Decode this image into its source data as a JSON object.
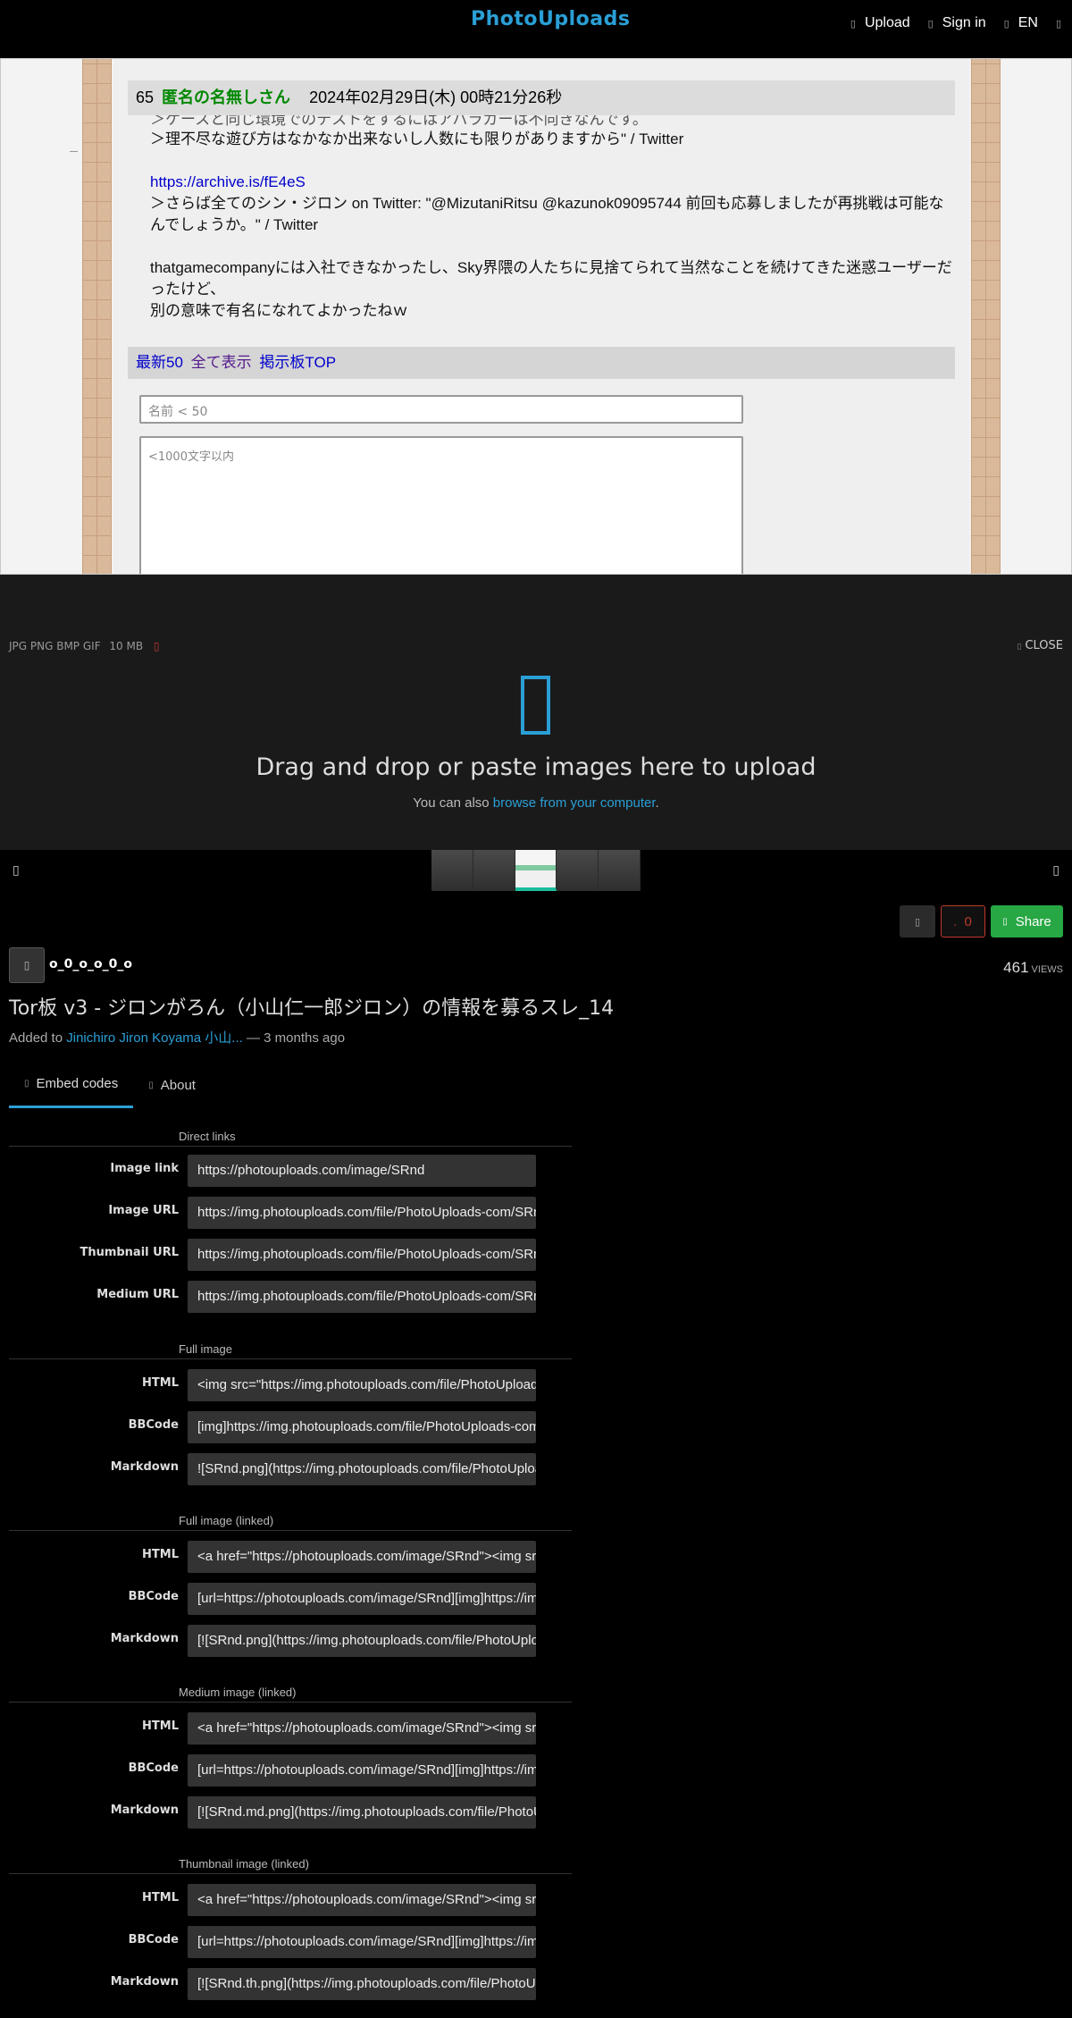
{
  "header": {
    "logo": "PhotoUploads",
    "nav": [
      {
        "icon": "upload-icon",
        "label": "Upload"
      },
      {
        "icon": "user-icon",
        "label": "Sign in"
      },
      {
        "icon": "globe-icon",
        "label": "EN"
      }
    ]
  },
  "preview": {
    "post_number": "65",
    "post_name": "匿名の名無しさん",
    "post_date": "2024年02月29日(木) 00時21分26秒",
    "line_partial": "＞ケースと同じ環境でのテストをするにはアバラガーは不向きなんです。",
    "line_1": "＞理不尽な遊び方はなかなか出来ないし人数にも限りがありますから\" / Twitter",
    "link": "https://archive.is/fE4eS",
    "line_2": "＞さらば全てのシン・ジロン on Twitter: \"@MizutaniRitsu @kazunok09095744 前回も応募しましたが再挑戦は可能なんでしょうか。\" / Twitter",
    "line_3": "thatgamecompanyには入社できなかったし、Sky界隈の人たちに見捨てられて当然なことを続けてきた迷惑ユーザーだったけど、",
    "line_4": "別の意味で有名になれてよかったねｗ",
    "nav_latest": "最新50",
    "nav_all": "全て表示",
    "nav_top": "掲示板TOP",
    "name_placeholder": "名前 < 50",
    "message_placeholder": "<1000文字以内"
  },
  "upload": {
    "formats": "JPG PNG BMP GIF",
    "max_size": "10 MB",
    "close": "CLOSE",
    "title": "Drag and drop or paste images here to upload",
    "sub_prefix": "You can also",
    "sub_link": "browse from your computer",
    "sub_suffix": "."
  },
  "image": {
    "likes": "0",
    "share": "Share",
    "username": "o_0_o_o_0_o",
    "views": "461",
    "views_label": "VIEWS",
    "title": "Tor板 v3 - ジロンがろん（小山仁一郎ジロン）の情報を募るスレ_14",
    "added_prefix": "Added to",
    "album": "Jinichiro Jiron Koyama 小山...",
    "added_suffix": "— 3 months ago"
  },
  "tabs": [
    {
      "icon": "code-icon",
      "label": "Embed codes"
    },
    {
      "icon": "info-icon",
      "label": "About"
    }
  ],
  "embed": {
    "direct": {
      "label": "Direct links",
      "rows": [
        {
          "label": "Image link",
          "value": "https://photouploads.com/image/SRnd"
        },
        {
          "label": "Image URL",
          "value": "https://img.photouploads.com/file/PhotoUploads-com/SRnd.png"
        },
        {
          "label": "Thumbnail URL",
          "value": "https://img.photouploads.com/file/PhotoUploads-com/SRnd.th.png"
        },
        {
          "label": "Medium URL",
          "value": "https://img.photouploads.com/file/PhotoUploads-com/SRnd.md.png"
        }
      ]
    },
    "full": {
      "label": "Full image",
      "rows": [
        {
          "label": "HTML",
          "value": "<img src=\"https://img.photouploads.com/file/PhotoUploads-com/SRnd.png\" alt=\"SRnd.png\" border=\"0\">"
        },
        {
          "label": "BBCode",
          "value": "[img]https://img.photouploads.com/file/PhotoUploads-com/SRnd.png[/img]"
        },
        {
          "label": "Markdown",
          "value": "![SRnd.png](https://img.photouploads.com/file/PhotoUploads-com/SRnd.png)"
        }
      ]
    },
    "full_linked": {
      "label": "Full image (linked)",
      "rows": [
        {
          "label": "HTML",
          "value": "<a href=\"https://photouploads.com/image/SRnd\"><img src=\"https://img.photouploads.com/file/PhotoUploads-com/SRnd.png\"></a>"
        },
        {
          "label": "BBCode",
          "value": "[url=https://photouploads.com/image/SRnd][img]https://img.photouploads.com/file/PhotoUploads-com/SRnd.png[/img][/url]"
        },
        {
          "label": "Markdown",
          "value": "[![SRnd.png](https://img.photouploads.com/file/PhotoUploads-com/SRnd.png)](https://photouploads.com/image/SRnd)"
        }
      ]
    },
    "medium_linked": {
      "label": "Medium image (linked)",
      "rows": [
        {
          "label": "HTML",
          "value": "<a href=\"https://photouploads.com/image/SRnd\"><img src=\"https://img.photouploads.com/file/PhotoUploads-com/SRnd.md.png\"></a>"
        },
        {
          "label": "BBCode",
          "value": "[url=https://photouploads.com/image/SRnd][img]https://img.photouploads.com/file/PhotoUploads-com/SRnd.md.png[/img][/url]"
        },
        {
          "label": "Markdown",
          "value": "[![SRnd.md.png](https://img.photouploads.com/file/PhotoUploads-com/SRnd.md.png)](https://photouploads.com/image/SRnd)"
        }
      ]
    },
    "thumb_linked": {
      "label": "Thumbnail image (linked)",
      "rows": [
        {
          "label": "HTML",
          "value": "<a href=\"https://photouploads.com/image/SRnd\"><img src=\"https://img.photouploads.com/file/PhotoUploads-com/SRnd.th.png\"></a>"
        },
        {
          "label": "BBCode",
          "value": "[url=https://photouploads.com/image/SRnd][img]https://img.photouploads.com/file/PhotoUploads-com/SRnd.th.png[/img][/url]"
        },
        {
          "label": "Markdown",
          "value": "[![SRnd.th.png](https://img.photouploads.com/file/PhotoUploads-com/SRnd.th.png)](https://photouploads.com/image/SRnd)"
        }
      ]
    }
  }
}
